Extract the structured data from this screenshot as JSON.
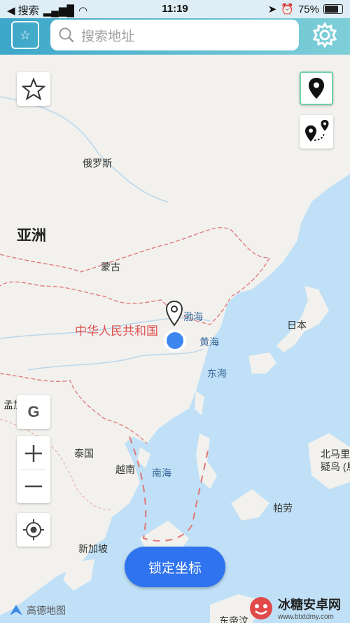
{
  "status_bar": {
    "back_label": "◀ 搜索",
    "time": "11:19",
    "battery": "75%"
  },
  "search": {
    "placeholder": "搜索地址"
  },
  "map": {
    "labels": {
      "russia": "俄罗斯",
      "asia": "亚洲",
      "mongolia": "蒙古",
      "china": "中华人民共和国",
      "bohai": "渤海",
      "yellow_sea": "黄海",
      "east_china_sea": "东海",
      "japan": "日本",
      "bangladesh": "孟加拉国",
      "thailand": "泰国",
      "vietnam": "越南",
      "south_china_sea": "南海",
      "north_maluku": "北马里",
      "north_maluku_2": "疑鸟 (鳥",
      "palau": "帕劳",
      "singapore": "新加坡",
      "east_timor": "东帝汶"
    }
  },
  "controls": {
    "g_label": "G",
    "lock_button": "锁定坐标",
    "brand": "高德地图"
  },
  "watermark": {
    "title": "冰糖安卓网",
    "url": "www.btxtdmy.com"
  },
  "colors": {
    "accent": "#2f73ee",
    "border": "#e07676"
  }
}
